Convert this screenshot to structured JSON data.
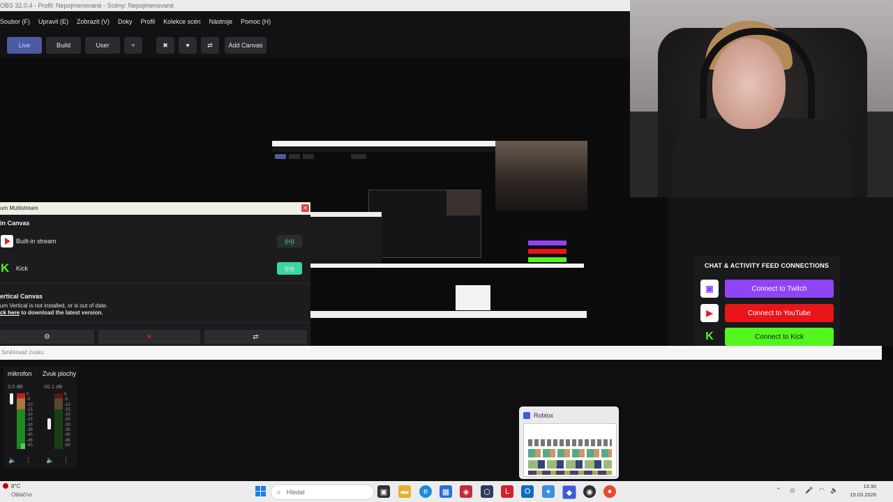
{
  "window": {
    "title": "OBS 32.0.4 - Profil: Nepojmenované - Scény: Nepojmenované"
  },
  "menu": [
    "Soubor (F)",
    "Upravit (E)",
    "Zobrazit (V)",
    "Doky",
    "Profil",
    "Kolekce scén",
    "Nástroje",
    "Pomoc (H)"
  ],
  "toolbar": {
    "live": "Live",
    "build": "Build",
    "user": "User",
    "add": "+",
    "tools_icon": "✖",
    "heart_icon": "♥",
    "refresh_icon": "⇄",
    "add_canvas": "Add Canvas"
  },
  "multistream": {
    "title": "um Multistream",
    "close": "✕",
    "main_canvas": "in Canvas",
    "builtin": "Built-in stream",
    "kick": "Kick",
    "toggle_icon": "((•))",
    "vertical_canvas": "ertical Canvas",
    "note_line1": "um Vertical is not installed, or is out of date.",
    "note_link": "ck here",
    "note_line2": " to download the latest version.",
    "gear": "⚙",
    "heart": "♥",
    "swap": "⇄"
  },
  "chat": {
    "title": "CHAT & ACTIVITY FEED CONNECTIONS",
    "twitch": "Connect to Twitch",
    "youtube": "Connect to YouTube",
    "kick": "Connect to Kick",
    "colors": {
      "twitch": "#8f45f5",
      "youtube": "#e8151b",
      "kick": "#53f51f"
    }
  },
  "mixer": {
    "header": "Směšovač zvuku",
    "channels": [
      {
        "name": "mikrofon",
        "db": "0.0 dB"
      },
      {
        "name": "Zvuk plochy",
        "db": "-20.1 dB"
      }
    ],
    "scale": [
      "0",
      "-5",
      "-10",
      "-15",
      "-20",
      "-25",
      "-30",
      "-35",
      "-40",
      "-45",
      "-50",
      "-55",
      "-60"
    ]
  },
  "roblox_popup": {
    "label": "Roblox"
  },
  "taskbar": {
    "weather_temp": "8°C",
    "weather_desc": "Oblačno",
    "search_placeholder": "Hledat",
    "time": "13:30",
    "date": "15.03.2026"
  }
}
